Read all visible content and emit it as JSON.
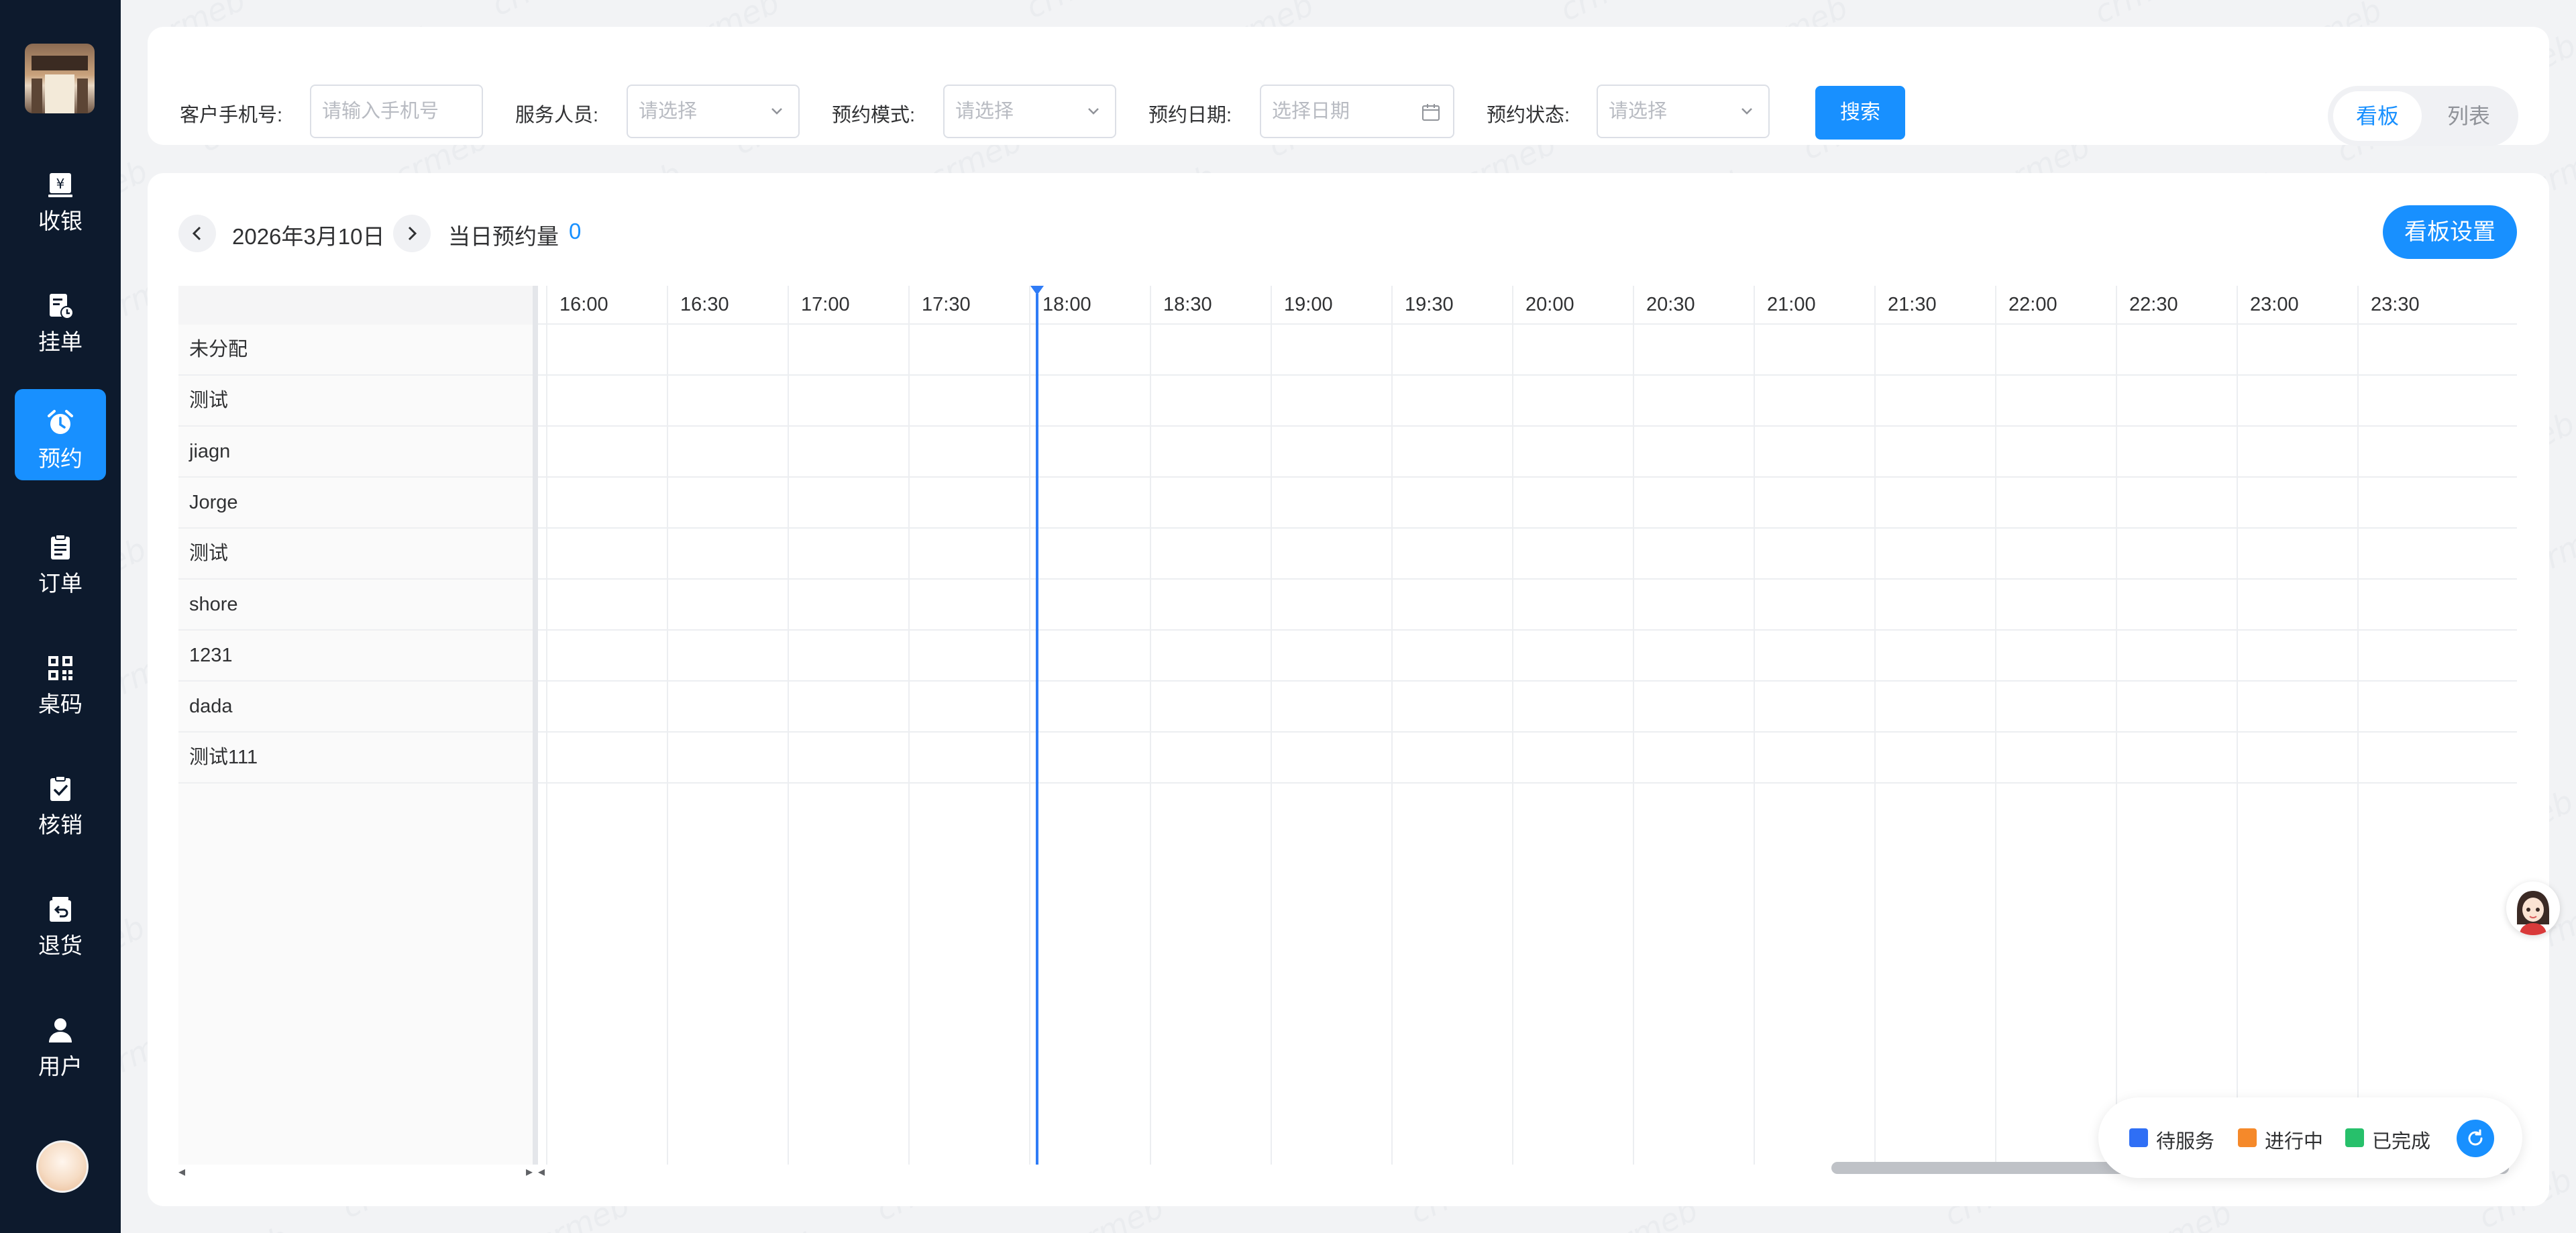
{
  "sidebar": {
    "items": [
      {
        "label": "收银",
        "icon": "cashier-icon"
      },
      {
        "label": "挂单",
        "icon": "pending-order-icon"
      },
      {
        "label": "预约",
        "icon": "alarm-clock-icon"
      },
      {
        "label": "订单",
        "icon": "order-clipboard-icon"
      },
      {
        "label": "桌码",
        "icon": "qr-code-icon"
      },
      {
        "label": "核销",
        "icon": "verify-check-icon"
      },
      {
        "label": "退货",
        "icon": "return-icon"
      },
      {
        "label": "用户",
        "icon": "user-icon"
      }
    ],
    "active_index": 2
  },
  "filters": {
    "phone_label": "客户手机号:",
    "phone_placeholder": "请输入手机号",
    "staff_label": "服务人员:",
    "staff_placeholder": "请选择",
    "mode_label": "预约模式:",
    "mode_placeholder": "请选择",
    "date_label": "预约日期:",
    "date_placeholder": "选择日期",
    "status_label": "预约状态:",
    "status_placeholder": "请选择",
    "search_label": "搜索"
  },
  "view_toggle": {
    "board": "看板",
    "list": "列表",
    "selected": "board"
  },
  "board": {
    "date": "2026年3月10日",
    "count_label": "当日预约量",
    "count_value": "0",
    "settings_label": "看板设置",
    "staff_rows": [
      "未分配",
      "测试",
      "jiagn",
      "Jorge",
      "测试",
      "shore",
      "1231",
      "dada",
      "测试111"
    ],
    "time_slots": [
      "16:00",
      "16:30",
      "17:00",
      "17:30",
      "18:00",
      "18:30",
      "19:00",
      "19:30",
      "20:00",
      "20:30",
      "21:00",
      "21:30",
      "22:00",
      "22:30",
      "23:00",
      "23:30"
    ],
    "current_time_marker": "18:00"
  },
  "legend": {
    "items": [
      {
        "label": "待服务",
        "color": "#2f6ff5"
      },
      {
        "label": "进行中",
        "color": "#f5892a"
      },
      {
        "label": "已完成",
        "color": "#27c06b"
      }
    ]
  },
  "colors": {
    "primary": "#1890ff",
    "sidebar_bg": "#0d1a2d",
    "now_line": "#2f7cf6"
  },
  "watermark_text": "crmeb"
}
